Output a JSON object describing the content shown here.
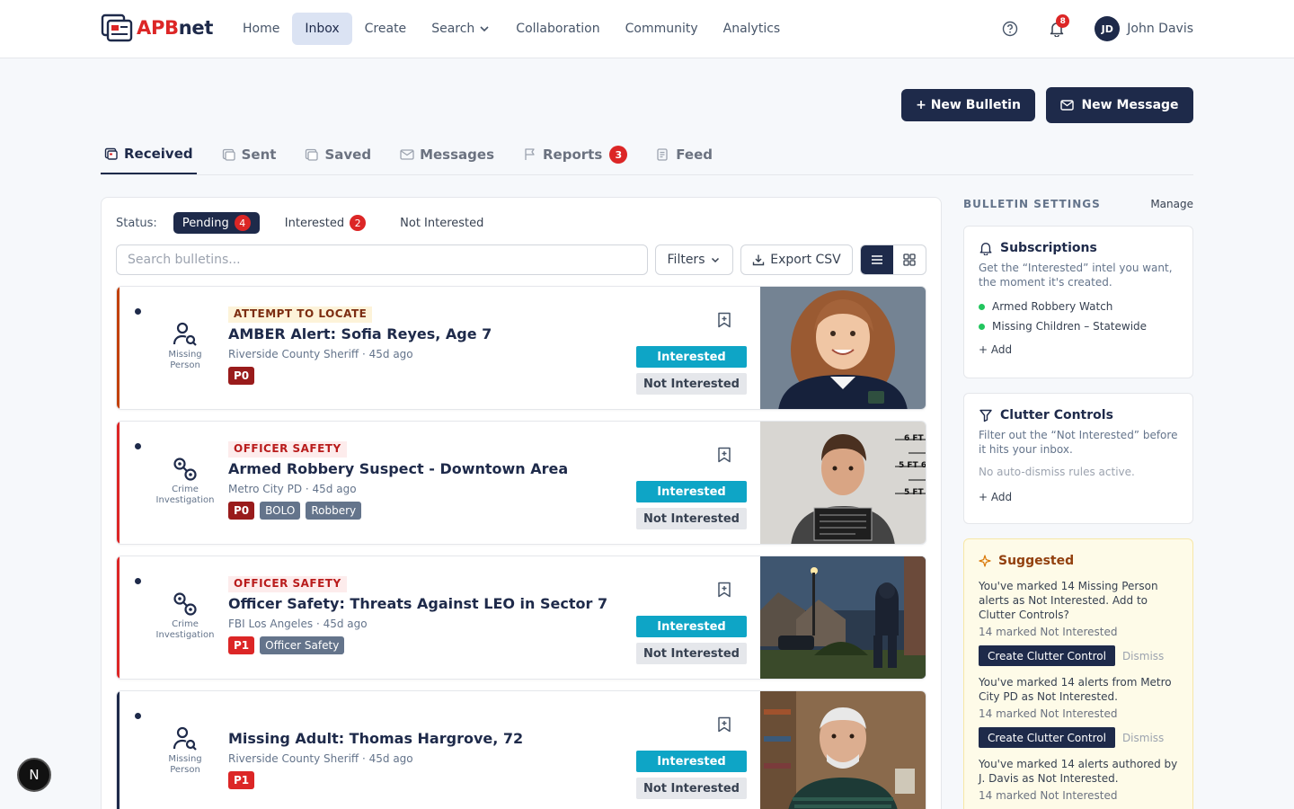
{
  "app": {
    "logo_prefix": "APB",
    "logo_suffix": "net"
  },
  "nav": {
    "links": [
      "Home",
      "Inbox",
      "Create",
      "Search",
      "Collaboration",
      "Community",
      "Analytics"
    ],
    "notif_count": "8",
    "user_initials": "JD",
    "user_name": "John Davis"
  },
  "actions": {
    "new_bulletin": "+ New Bulletin",
    "new_message": "New Message"
  },
  "tabs": [
    {
      "label": "Received"
    },
    {
      "label": "Sent"
    },
    {
      "label": "Saved"
    },
    {
      "label": "Messages"
    },
    {
      "label": "Reports",
      "badge": "3"
    },
    {
      "label": "Feed"
    }
  ],
  "filters": {
    "status_label": "Status:",
    "pending": "Pending",
    "pending_count": "4",
    "interested": "Interested",
    "interested_count": "2",
    "not_interested": "Not Interested",
    "search_placeholder": "Search bulletins...",
    "filters_label": "Filters",
    "export_label": "Export CSV"
  },
  "buttons": {
    "interested": "Interested",
    "not_interested": "Not Interested"
  },
  "bulletins": [
    {
      "type": "ATTEMPT TO LOCATE",
      "title": "AMBER Alert: Sofia Reyes, Age 7",
      "agency": "Riverside County Sheriff · 45d ago",
      "category_1": "Missing",
      "category_2": "Person",
      "tags": [
        "P0"
      ]
    },
    {
      "type": "OFFICER SAFETY",
      "title": "Armed Robbery Suspect - Downtown Area",
      "agency": "Metro City PD · 45d ago",
      "category_1": "Crime",
      "category_2": "Investigation",
      "tags": [
        "P0",
        "BOLO",
        "Robbery"
      ],
      "photo_text_1": "6 FT",
      "photo_text_2": "5 FT 6",
      "photo_text_3": "5 FT"
    },
    {
      "type": "OFFICER SAFETY",
      "title": "Officer Safety: Threats Against LEO in Sector 7",
      "agency": "FBI Los Angeles · 45d ago",
      "category_1": "Crime",
      "category_2": "Investigation",
      "tags": [
        "P1",
        "Officer Safety"
      ]
    },
    {
      "type": "",
      "title": "Missing Adult: Thomas Hargrove, 72",
      "agency": "Riverside County Sheriff · 45d ago",
      "category_1": "Missing",
      "category_2": "Person",
      "tags": [
        "P1"
      ]
    }
  ],
  "sidebar": {
    "title": "BULLETIN SETTINGS",
    "manage": "Manage",
    "subscriptions": {
      "title": "Subscriptions",
      "desc": "Get the “Interested” intel you want, the moment it's created.",
      "items": [
        "Armed Robbery Watch",
        "Missing Children – Statewide"
      ],
      "add": "+ Add"
    },
    "clutter": {
      "title": "Clutter Controls",
      "desc": "Filter out the “Not Interested” before it hits your inbox.",
      "empty": "No auto-dismiss rules active.",
      "add": "+ Add"
    },
    "suggested": {
      "title": "Suggested",
      "items": [
        {
          "text": "You've marked 14 Missing Person alerts as Not Interested. Add to Clutter Controls?",
          "sub": "14 marked Not Interested"
        },
        {
          "text": "You've marked 14 alerts from Metro City PD as Not Interested.",
          "sub": "14 marked Not Interested"
        },
        {
          "text": "You've marked 14 alerts authored by J. Davis as Not Interested.",
          "sub": "14 marked Not Interested"
        }
      ],
      "create_label": "Create Clutter Control",
      "dismiss_label": "Dismiss"
    }
  },
  "dev_badge": "N",
  "colors": {
    "navy": "#1e2a4a",
    "accent_red": "#dc2626",
    "accent_orange": "#c2410c",
    "interested": "#0ea5c6"
  }
}
